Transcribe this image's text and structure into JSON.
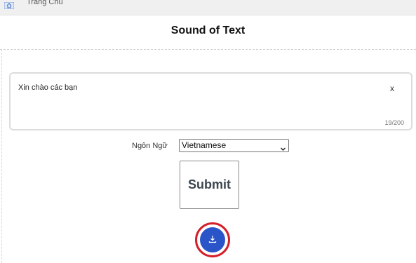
{
  "topbar": {
    "home_label": "Trang Chủ",
    "home_icon": "home-icon"
  },
  "page": {
    "title": "Sound of Text"
  },
  "text_input": {
    "value": "Xin chào các bạn",
    "clear_label": "x",
    "char_count": "19/200"
  },
  "language": {
    "label": "Ngôn Ngữ",
    "selected": "Vietnamese"
  },
  "submit": {
    "label": "Submit"
  },
  "download": {
    "icon": "download-icon",
    "button_color": "#2a55c8",
    "ring_color": "#d3202a"
  }
}
